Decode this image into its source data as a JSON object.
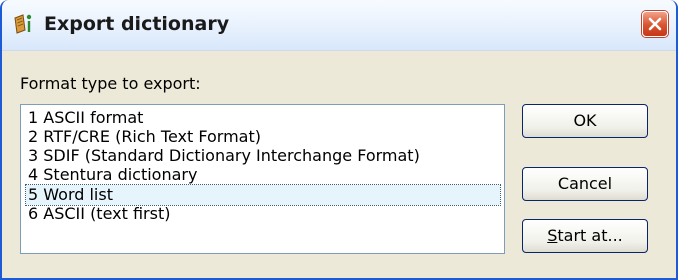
{
  "window": {
    "title": "Export dictionary",
    "icon": "dictionary-app-icon",
    "close_icon": "close-icon"
  },
  "format_label": "Format type to export:",
  "formats": [
    "1 ASCII format",
    "2 RTF/CRE (Rich Text Format)",
    "3 SDIF (Standard Dictionary Interchange Format)",
    "4 Stentura dictionary",
    "5 Word list",
    "6 ASCII (text first)"
  ],
  "focused_format_index": 4,
  "buttons": {
    "ok": "OK",
    "cancel": "Cancel",
    "start_at_mnemonic": "S",
    "start_at_rest": "tart at..."
  },
  "colors": {
    "title_bar": "#e6f0fd",
    "close_button": "#d9532e",
    "dialog_background": "#ece9d8",
    "frame": "#1c5ad6"
  }
}
